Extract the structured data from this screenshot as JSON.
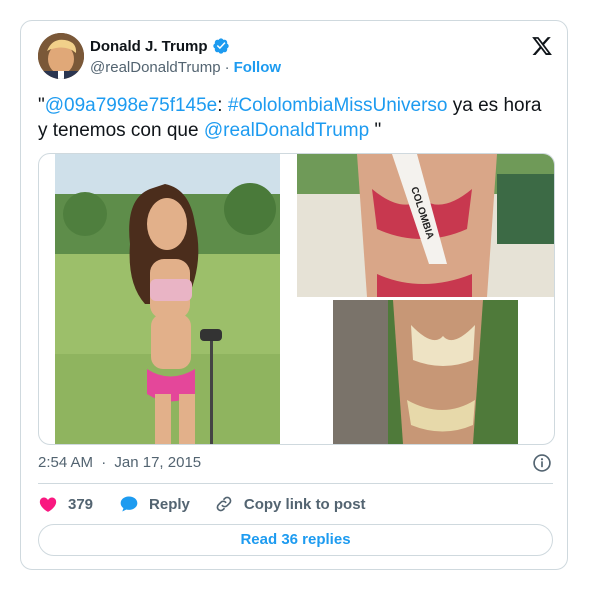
{
  "author": {
    "name": "Donald J. Trump",
    "handle": "@realDonaldTrump",
    "separator": "·",
    "follow_label": "Follow",
    "avatar_icon": "user-avatar",
    "verified_icon": "verified-badge-icon",
    "verified_color": "#1d9bf0"
  },
  "tweet": {
    "quote_open": "\"",
    "mention1": "@09a7998e75f145e",
    "colon": ":",
    "hashtag": "#CololombiaMissUniverso",
    "text_mid": " ya es hora y tenemos con que ",
    "mention2": "@realDonaldTrump",
    "quote_close": " \""
  },
  "media": {
    "images": [
      {
        "icon": "photo-golf-course"
      },
      {
        "icon": "photo-colombia-sash"
      },
      {
        "icon": "photo-tree-bikini"
      }
    ]
  },
  "meta": {
    "time": "2:54 AM",
    "separator": "·",
    "date": "Jan 17, 2015"
  },
  "actions": {
    "like_count": "379",
    "reply_label": "Reply",
    "copy_label": "Copy link to post",
    "like_color": "#f91880",
    "link_color": "#1d9bf0"
  },
  "read_replies_label": "Read 36 replies",
  "sash_text": "COLOMBIA"
}
